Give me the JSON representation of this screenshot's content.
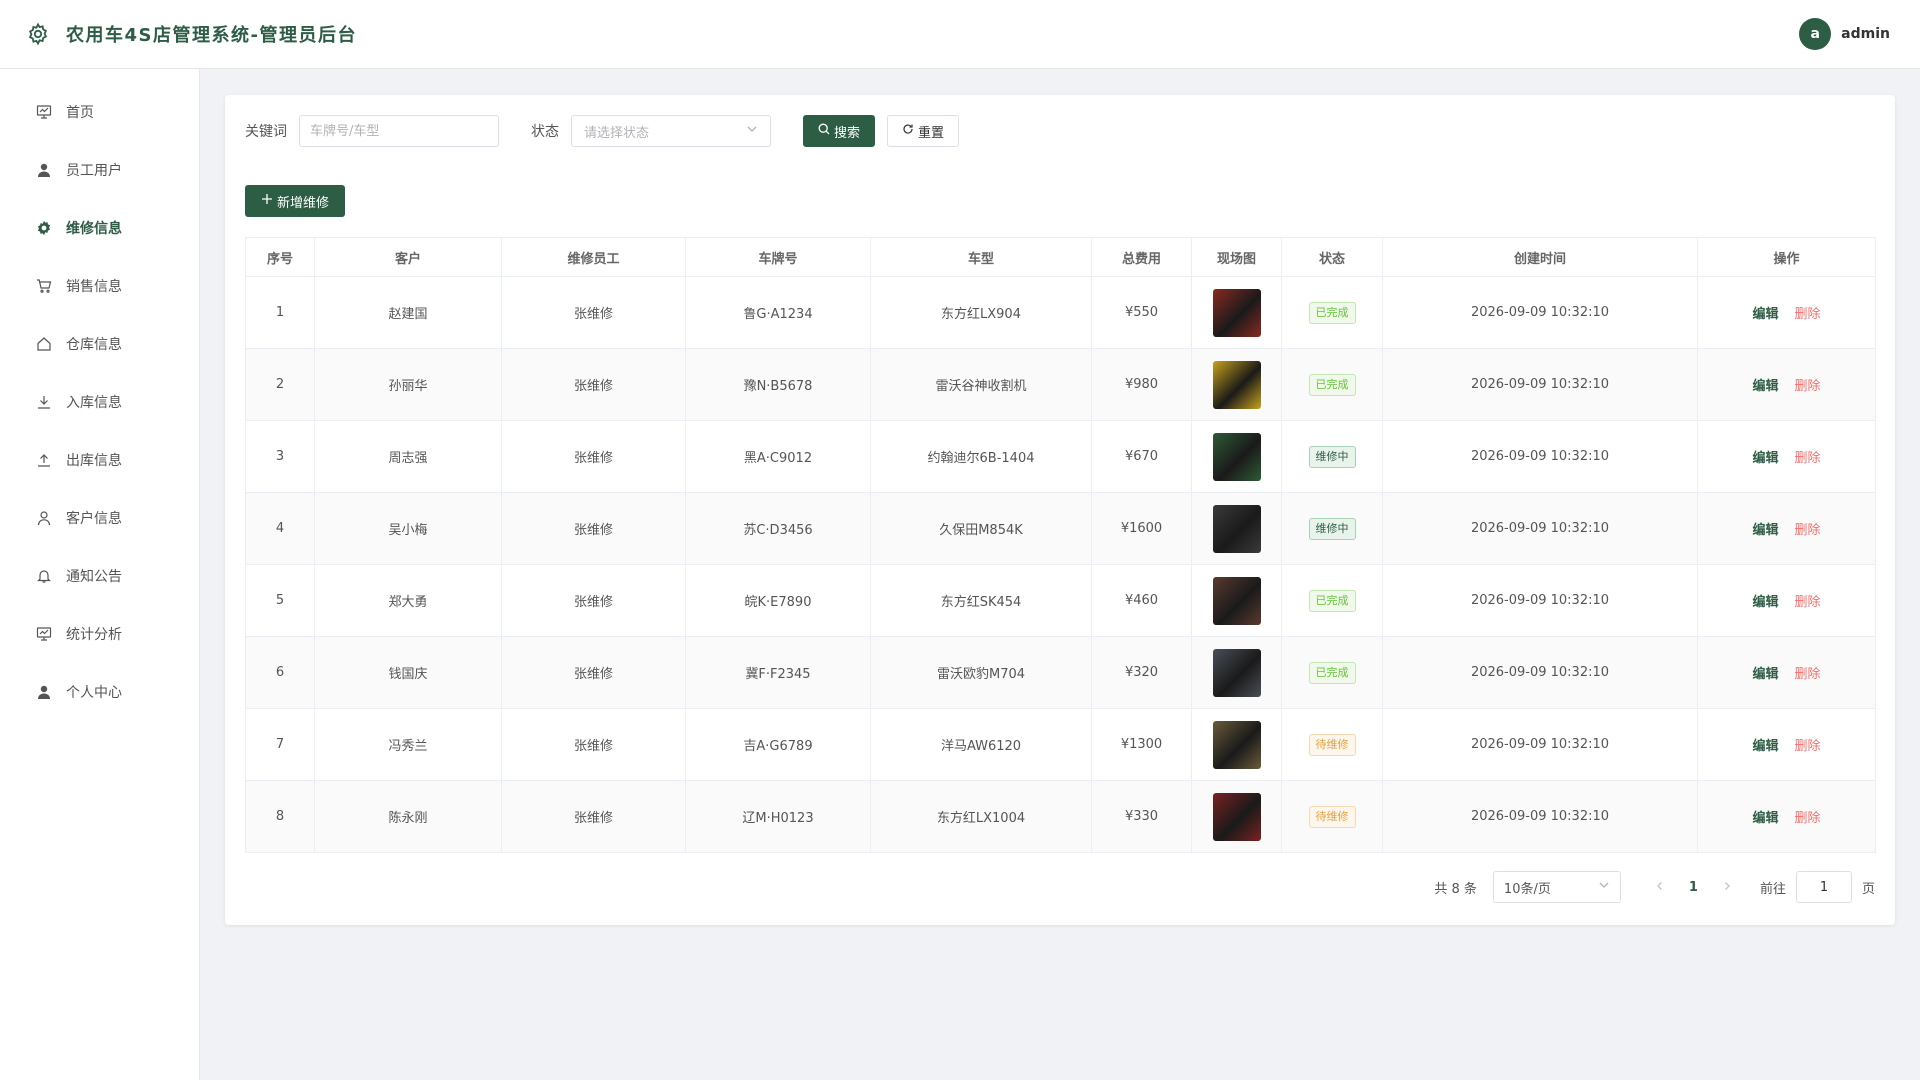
{
  "header": {
    "title": "农用车4S店管理系统-管理员后台",
    "avatar_letter": "a",
    "username": "admin"
  },
  "sidebar": {
    "items": [
      {
        "label": "首页",
        "icon": "dashboard-icon"
      },
      {
        "label": "员工用户",
        "icon": "user-icon"
      },
      {
        "label": "维修信息",
        "icon": "gear-icon",
        "active": true
      },
      {
        "label": "销售信息",
        "icon": "cart-icon"
      },
      {
        "label": "仓库信息",
        "icon": "home-icon"
      },
      {
        "label": "入库信息",
        "icon": "download-icon"
      },
      {
        "label": "出库信息",
        "icon": "upload-icon"
      },
      {
        "label": "客户信息",
        "icon": "person-outline-icon"
      },
      {
        "label": "通知公告",
        "icon": "bell-icon"
      },
      {
        "label": "统计分析",
        "icon": "chart-icon"
      },
      {
        "label": "个人中心",
        "icon": "user-icon"
      }
    ]
  },
  "filter": {
    "keyword_label": "关键词",
    "keyword_placeholder": "车牌号/车型",
    "status_label": "状态",
    "status_placeholder": "请选择状态",
    "search_label": "搜索",
    "reset_label": "重置"
  },
  "add_button_label": "新增维修",
  "table": {
    "headers": [
      "序号",
      "客户",
      "维修员工",
      "车牌号",
      "车型",
      "总费用",
      "现场图",
      "状态",
      "创建时间",
      "操作"
    ],
    "edit_label": "编辑",
    "delete_label": "删除",
    "rows": [
      {
        "no": "1",
        "customer": "赵建国",
        "staff": "张维修",
        "plate": "鲁G·A1234",
        "model": "东方红LX904",
        "cost": "¥550",
        "status": "已完成",
        "status_type": "done",
        "created": "2026-09-09 10:32:10",
        "photo_color": "#8a2a22"
      },
      {
        "no": "2",
        "customer": "孙丽华",
        "staff": "张维修",
        "plate": "豫N·B5678",
        "model": "雷沃谷神收割机",
        "cost": "¥980",
        "status": "已完成",
        "status_type": "done",
        "created": "2026-09-09 10:32:10",
        "photo_color": "#c9a21c"
      },
      {
        "no": "3",
        "customer": "周志强",
        "staff": "张维修",
        "plate": "黑A·C9012",
        "model": "约翰迪尔6B-1404",
        "cost": "¥670",
        "status": "维修中",
        "status_type": "repair",
        "created": "2026-09-09 10:32:10",
        "photo_color": "#2f5a35"
      },
      {
        "no": "4",
        "customer": "吴小梅",
        "staff": "张维修",
        "plate": "苏C·D3456",
        "model": "久保田M854K",
        "cost": "¥1600",
        "status": "维修中",
        "status_type": "repair",
        "created": "2026-09-09 10:32:10",
        "photo_color": "#3a3a3a"
      },
      {
        "no": "5",
        "customer": "郑大勇",
        "staff": "张维修",
        "plate": "皖K·E7890",
        "model": "东方红SK454",
        "cost": "¥460",
        "status": "已完成",
        "status_type": "done",
        "created": "2026-09-09 10:32:10",
        "photo_color": "#5a3a30"
      },
      {
        "no": "6",
        "customer": "钱国庆",
        "staff": "张维修",
        "plate": "冀F·F2345",
        "model": "雷沃欧豹M704",
        "cost": "¥320",
        "status": "已完成",
        "status_type": "done",
        "created": "2026-09-09 10:32:10",
        "photo_color": "#4a4f58"
      },
      {
        "no": "7",
        "customer": "冯秀兰",
        "staff": "张维修",
        "plate": "吉A·G6789",
        "model": "洋马AW6120",
        "cost": "¥1300",
        "status": "待维修",
        "status_type": "wait",
        "created": "2026-09-09 10:32:10",
        "photo_color": "#6b5a3a"
      },
      {
        "no": "8",
        "customer": "陈永刚",
        "staff": "张维修",
        "plate": "辽M·H0123",
        "model": "东方红LX1004",
        "cost": "¥330",
        "status": "待维修",
        "status_type": "wait",
        "created": "2026-09-09 10:32:10",
        "photo_color": "#7a2222"
      }
    ]
  },
  "pager": {
    "total_label": "共 8 条",
    "page_size": "10条/页",
    "current_page": "1",
    "goto_label": "前往",
    "goto_value": "1",
    "page_suffix": "页"
  }
}
